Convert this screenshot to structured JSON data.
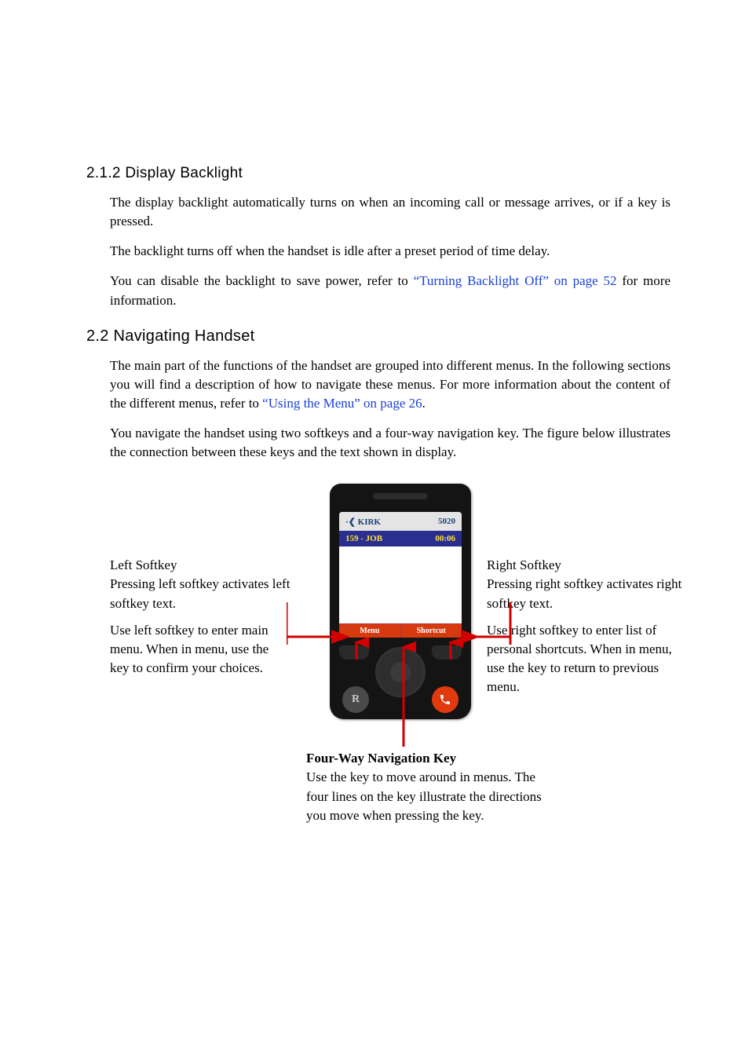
{
  "section213": {
    "heading": "2.1.2  Display Backlight",
    "p1": "The display backlight automatically turns on when an incoming call or message arrives, or if a key is pressed.",
    "p2": "The backlight turns off when the handset is idle after a preset period of time delay.",
    "p3a": "You can disable the backlight to save power, refer to ",
    "p3link": "“Turning Backlight Off” on page 52",
    "p3b": " for more information."
  },
  "section22": {
    "heading": "2.2  Navigating Handset",
    "p1a": "The main part of the functions of the handset are grouped into different menus. In the following sections you will find a description of how to navigate these menus. For more information about the content of the different menus, refer to ",
    "p1link": "“Using the Menu” on page 26",
    "p1b": ".",
    "p2": "You navigate the handset using two softkeys and a four-way navigation key. The figure below illustrates the connection between these keys and the text shown in display."
  },
  "phone": {
    "brand": "KIRK",
    "model": "5020",
    "title_left": "159 - JOB",
    "title_right": "00:06",
    "softkey_left": "Menu",
    "softkey_right": "Shortcut",
    "r_label": "R"
  },
  "fig": {
    "left_title": "Left Softkey",
    "left_body1": "Pressing left softkey activates left softkey text.",
    "left_body2": "Use left softkey to enter main menu. When in menu, use the key to confirm your choices.",
    "right_title": "Right Softkey",
    "right_body1": "Pressing right softkey activates right softkey text.",
    "right_body2": "Use right softkey to enter list of personal shortcuts. When in menu, use the key to return to previous menu.",
    "nav_title": "Four-Way Navigation Key",
    "nav_body": "Use the key to move around in menus. The four lines on the key illustrate the directions you move when pressing the key."
  }
}
